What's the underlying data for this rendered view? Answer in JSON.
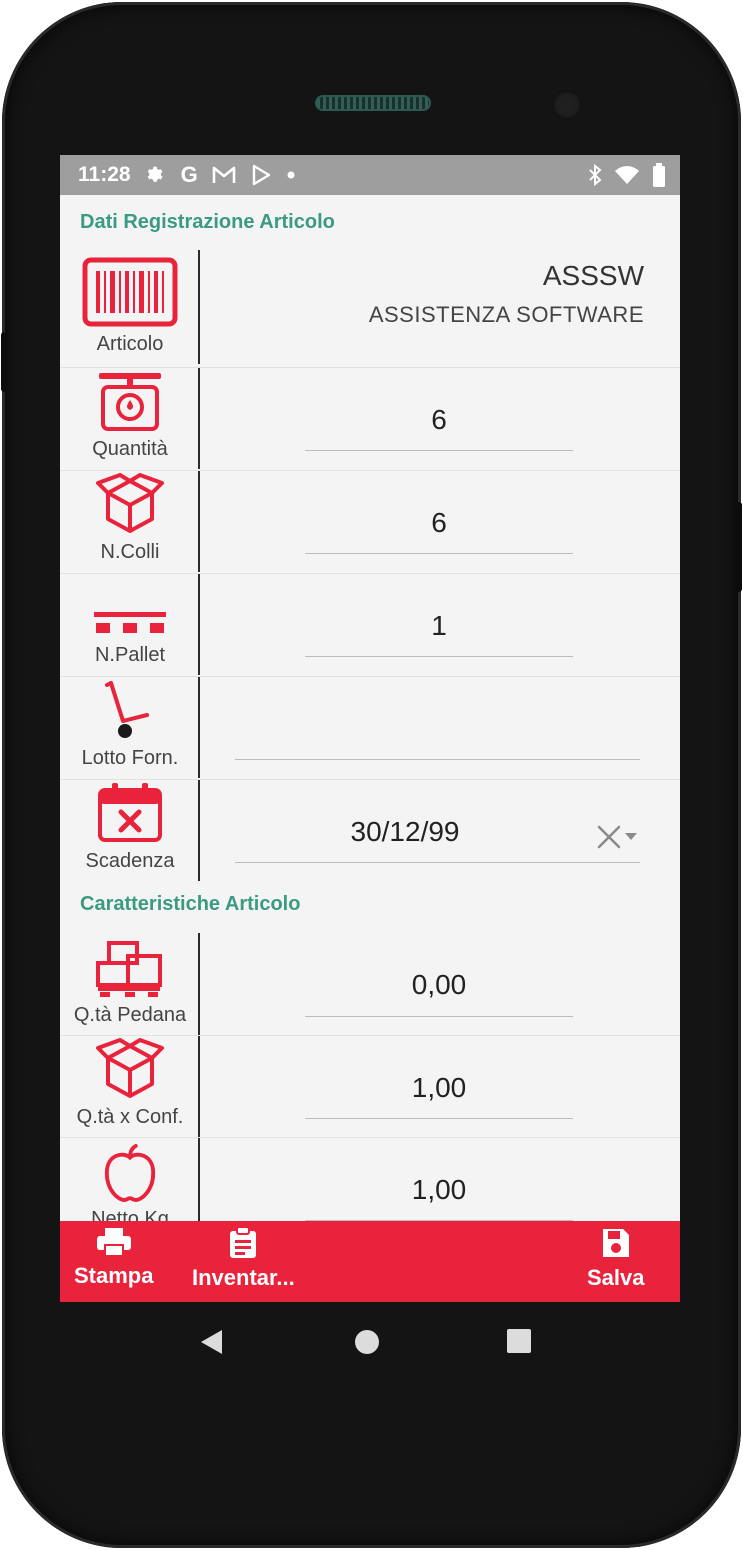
{
  "status_bar": {
    "time": "11:28",
    "left_icons": [
      "settings-icon",
      "google-icon",
      "gmail-icon",
      "play-store-icon",
      "notification-dot-icon"
    ],
    "right_icons": [
      "bluetooth-icon",
      "wifi-icon",
      "battery-icon"
    ]
  },
  "section1": {
    "title": "Dati Registrazione Articolo"
  },
  "fields": {
    "articolo": {
      "label": "Articolo",
      "code": "ASSSW",
      "description": "ASSISTENZA SOFTWARE",
      "icon": "barcode-icon"
    },
    "quantita": {
      "label": "Quantità",
      "value": "6",
      "icon": "scale-icon"
    },
    "ncolli": {
      "label": "N.Colli",
      "value": "6",
      "icon": "box-icon"
    },
    "npallet": {
      "label": "N.Pallet",
      "value": "1",
      "icon": "pallet-icon"
    },
    "lotto": {
      "label": "Lotto Forn.",
      "value": "",
      "icon": "hand-truck-icon"
    },
    "scadenza": {
      "label": "Scadenza",
      "value": "30/12/99",
      "icon": "calendar-icon"
    }
  },
  "section2": {
    "title": "Caratteristiche Articolo"
  },
  "features": {
    "qta_pedana": {
      "label": "Q.tà Pedana",
      "value": "0,00",
      "icon": "boxes-on-pallet-icon"
    },
    "qta_conf": {
      "label": "Q.tà x Conf.",
      "value": "1,00",
      "icon": "box-icon"
    },
    "netto": {
      "label": "Netto Kg",
      "value": "1,00",
      "icon": "apple-icon"
    }
  },
  "toolbar": {
    "print_label": "Stampa",
    "inventory_label": "Inventar...",
    "save_label": "Salva"
  },
  "colors": {
    "accent_red": "#e8233b",
    "section_green": "#3a9a82",
    "status_bar": "#9e9e9e"
  }
}
